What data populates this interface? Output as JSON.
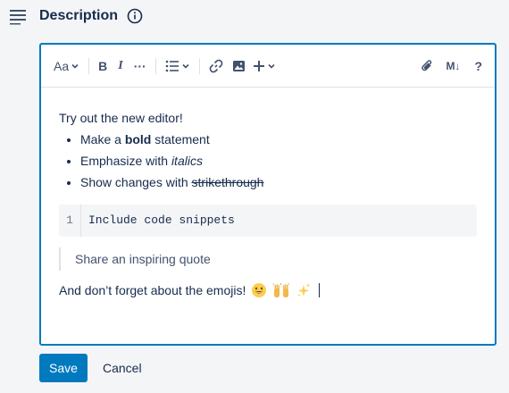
{
  "header": {
    "title": "Description",
    "icon": "description-lines-icon",
    "info_icon": "info-icon"
  },
  "toolbar": {
    "text_style_label": "Aa",
    "bold_label": "B",
    "italic_label": "I",
    "more_label": "···",
    "markdown_label": "M↓",
    "help_label": "?"
  },
  "content": {
    "intro": "Try out the new editor!",
    "bullets": [
      {
        "prefix": "Make a ",
        "emphasis": "bold",
        "suffix": " statement"
      },
      {
        "prefix": "Emphasize with ",
        "emphasis": "italics",
        "suffix": ""
      },
      {
        "prefix": "Show changes with ",
        "emphasis": "strikethrough",
        "suffix": ""
      }
    ],
    "code_line_number": "1",
    "code_text": "Include code snippets",
    "quote": "Share an inspiring quote",
    "emoji_text": "And don’t forget about the emojis!",
    "emojis": [
      "grinning-face",
      "raising-hands",
      "sparkles"
    ]
  },
  "actions": {
    "save_label": "Save",
    "cancel_label": "Cancel"
  },
  "colors": {
    "accent": "#0079bf",
    "text": "#172b4d",
    "muted": "#42526e",
    "background": "#f4f5f7"
  }
}
